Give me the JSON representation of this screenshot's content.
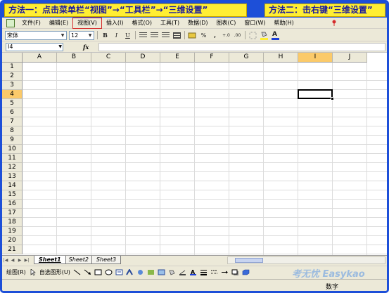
{
  "annotations": {
    "method_1": "方法一：点击菜单栏“视图”→“工具栏”→“三维设置”",
    "method_2": "方法二：击右键“三维设置”"
  },
  "menu": {
    "items": [
      {
        "label": "文件(F)",
        "active": false
      },
      {
        "label": "编辑(E)",
        "active": false
      },
      {
        "label": "视图(V)",
        "active": true
      },
      {
        "label": "插入(I)",
        "active": false
      },
      {
        "label": "格式(O)",
        "active": false
      },
      {
        "label": "工具(T)",
        "active": false
      },
      {
        "label": "数据(D)",
        "active": false
      },
      {
        "label": "图表(C)",
        "active": false
      },
      {
        "label": "窗口(W)",
        "active": false
      },
      {
        "label": "帮助(H)",
        "active": false
      }
    ]
  },
  "format_toolbar": {
    "font_name": "宋体",
    "font_size": "12",
    "bold": "B",
    "italic": "I",
    "underline": "U",
    "percent": "%",
    "comma": ",",
    "inc_decimal": "+.0",
    "dec_decimal": ".00",
    "font_color_letter": "A"
  },
  "formula_bar": {
    "name_box": "I4",
    "fx_label": "fx",
    "formula": ""
  },
  "grid": {
    "columns": [
      "A",
      "B",
      "C",
      "D",
      "E",
      "F",
      "G",
      "H",
      "I",
      "J"
    ],
    "rows": [
      "1",
      "2",
      "3",
      "4",
      "5",
      "6",
      "7",
      "8",
      "9",
      "10",
      "11",
      "12",
      "13",
      "14",
      "15",
      "16",
      "17",
      "18",
      "19",
      "20",
      "21"
    ],
    "selected_column": "I",
    "selected_row": "4"
  },
  "sheets": [
    {
      "label": "Sheet1",
      "active": true
    },
    {
      "label": "Sheet2",
      "active": false
    },
    {
      "label": "Sheet3",
      "active": false
    }
  ],
  "draw_toolbar": {
    "draw_label": "绘图(R)",
    "autoshapes_label": "自选图形(U)"
  },
  "status": {
    "mode": "数字"
  },
  "watermark": "考无忧 Easykao",
  "colors": {
    "accent_blue": "#1d4fd8",
    "callout_yellow": "#ffee33",
    "selection_orange": "#fbca6a",
    "highlight_red": "#d42a2a"
  }
}
